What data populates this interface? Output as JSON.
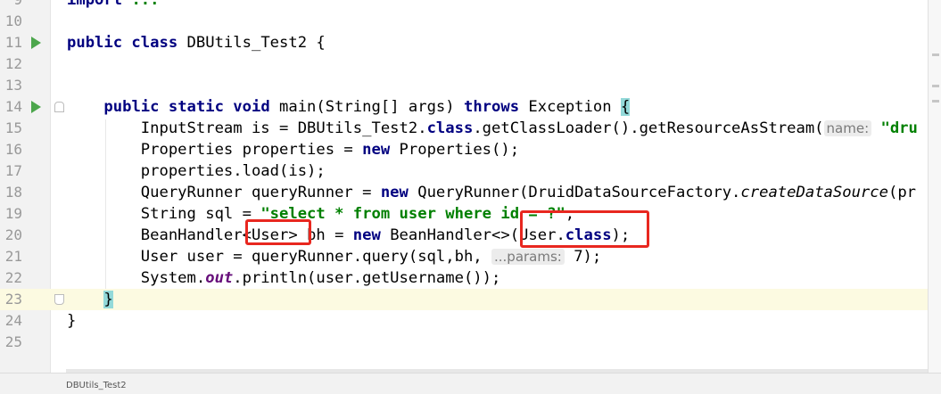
{
  "editor": {
    "lines": [
      {
        "n": "9",
        "runnable": false,
        "current": false,
        "fold": "",
        "html_parts": [
          {
            "t": "import ",
            "c": "kw"
          },
          {
            "t": "...",
            "c": "fold"
          }
        ]
      },
      {
        "n": "10",
        "runnable": false,
        "current": false,
        "fold": "",
        "html_parts": []
      },
      {
        "n": "11",
        "runnable": true,
        "current": false,
        "fold": "",
        "html_parts": [
          {
            "t": "public class ",
            "c": "kw"
          },
          {
            "t": "DBUtils_Test2 {",
            "c": ""
          }
        ]
      },
      {
        "n": "12",
        "runnable": false,
        "current": false,
        "fold": "",
        "html_parts": []
      },
      {
        "n": "13",
        "runnable": false,
        "current": false,
        "fold": "",
        "html_parts": []
      },
      {
        "n": "14",
        "runnable": true,
        "current": false,
        "fold": "top",
        "html_parts": [
          {
            "t": "    ",
            "c": ""
          },
          {
            "t": "public static void ",
            "c": "kw"
          },
          {
            "t": "main(String[] args) ",
            "c": ""
          },
          {
            "t": "throws ",
            "c": "kw"
          },
          {
            "t": "Exception ",
            "c": ""
          },
          {
            "t": "{",
            "c": "brace"
          }
        ]
      },
      {
        "n": "15",
        "runnable": false,
        "current": false,
        "fold": "",
        "html_parts": [
          {
            "t": "        InputStream is = DBUtils_Test2.",
            "c": ""
          },
          {
            "t": "class",
            "c": "kw"
          },
          {
            "t": ".getClassLoader().getResourceAsStream(",
            "c": ""
          },
          {
            "t": "name:",
            "c": "hint"
          },
          {
            "t": " ",
            "c": ""
          },
          {
            "t": "\"dru",
            "c": "str"
          }
        ]
      },
      {
        "n": "16",
        "runnable": false,
        "current": false,
        "fold": "",
        "html_parts": [
          {
            "t": "        Properties properties = ",
            "c": ""
          },
          {
            "t": "new ",
            "c": "kw"
          },
          {
            "t": "Properties();",
            "c": ""
          }
        ]
      },
      {
        "n": "17",
        "runnable": false,
        "current": false,
        "fold": "",
        "html_parts": [
          {
            "t": "        properties.load(is);",
            "c": ""
          }
        ]
      },
      {
        "n": "18",
        "runnable": false,
        "current": false,
        "fold": "",
        "html_parts": [
          {
            "t": "        QueryRunner queryRunner = ",
            "c": ""
          },
          {
            "t": "new ",
            "c": "kw"
          },
          {
            "t": "QueryRunner(DruidDataSourceFactory.",
            "c": ""
          },
          {
            "t": "createDataSource",
            "c": "static-m"
          },
          {
            "t": "(pr",
            "c": ""
          }
        ]
      },
      {
        "n": "19",
        "runnable": false,
        "current": false,
        "fold": "",
        "html_parts": [
          {
            "t": "        String sql = ",
            "c": ""
          },
          {
            "t": "\"select * from user where id = ?\"",
            "c": "str"
          },
          {
            "t": ";",
            "c": ""
          }
        ]
      },
      {
        "n": "20",
        "runnable": false,
        "current": false,
        "fold": "",
        "html_parts": [
          {
            "t": "        BeanHandler<User> bh = ",
            "c": ""
          },
          {
            "t": "new ",
            "c": "kw"
          },
          {
            "t": "BeanHandler<>(User.",
            "c": ""
          },
          {
            "t": "class",
            "c": "kw"
          },
          {
            "t": ");",
            "c": ""
          }
        ]
      },
      {
        "n": "21",
        "runnable": false,
        "current": false,
        "fold": "",
        "html_parts": [
          {
            "t": "        User user = queryRunner.query(sql,bh, ",
            "c": ""
          },
          {
            "t": "...params:",
            "c": "hint"
          },
          {
            "t": " 7);",
            "c": ""
          }
        ]
      },
      {
        "n": "22",
        "runnable": false,
        "current": false,
        "fold": "",
        "html_parts": [
          {
            "t": "        System.",
            "c": ""
          },
          {
            "t": "out",
            "c": "field"
          },
          {
            "t": ".println(user.getUsername());",
            "c": ""
          }
        ]
      },
      {
        "n": "23",
        "runnable": false,
        "current": true,
        "fold": "bottom",
        "html_parts": [
          {
            "t": "    ",
            "c": ""
          },
          {
            "t": "}",
            "c": "brace"
          }
        ]
      },
      {
        "n": "24",
        "runnable": false,
        "current": false,
        "fold": "",
        "html_parts": [
          {
            "t": "}",
            "c": ""
          }
        ]
      },
      {
        "n": "25",
        "runnable": false,
        "current": false,
        "fold": "",
        "html_parts": []
      }
    ]
  },
  "status_bar": {
    "breadcrumb": "DBUtils_Test2"
  },
  "colors": {
    "keyword": "#000080",
    "string": "#008000",
    "annotation_box": "#e8271f",
    "run_icon": "#4ca64c",
    "current_line": "#fcfae1"
  },
  "icons": {
    "run": "run-gutter-icon",
    "fold": "fold-marker-icon"
  }
}
